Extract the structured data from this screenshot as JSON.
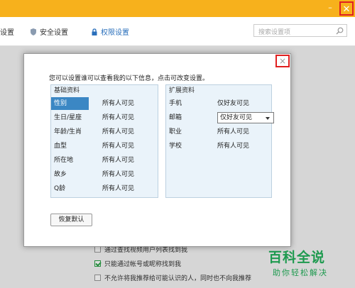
{
  "window": {
    "minimize_icon": "minus",
    "close_icon": "x"
  },
  "nav": {
    "items": [
      {
        "label": "设置",
        "icon": "none"
      },
      {
        "label": "安全设置",
        "icon": "shield-icon"
      },
      {
        "label": "权限设置",
        "icon": "lock-icon"
      }
    ],
    "search_placeholder": "搜索设置项"
  },
  "background_options": [
    {
      "label": "通过查找视频用户列表找到我",
      "checked": false
    },
    {
      "label": "只能通过帐号或昵称找到我",
      "checked": true
    },
    {
      "label": "不允许将我推荐给可能认识的人，同时也不向我推荐",
      "checked": false
    }
  ],
  "dialog": {
    "close_label": "×",
    "intro": "您可以设置谁可以查看我的以下信息，点击可改变设置。",
    "basic": {
      "title": "基础资料",
      "rows": [
        {
          "field": "性别",
          "value": "所有人可见"
        },
        {
          "field": "生日/星座",
          "value": "所有人可见"
        },
        {
          "field": "年龄/生肖",
          "value": "所有人可见"
        },
        {
          "field": "血型",
          "value": "所有人可见"
        },
        {
          "field": "所在地",
          "value": "所有人可见"
        },
        {
          "field": "故乡",
          "value": "所有人可见"
        },
        {
          "field": "Q龄",
          "value": "所有人可见"
        }
      ]
    },
    "extended": {
      "title": "扩展资料",
      "rows": [
        {
          "field": "手机",
          "value": "仅好友可见"
        },
        {
          "field": "邮箱",
          "value": "仅好友可见"
        },
        {
          "field": "职业",
          "value": "所有人可见"
        },
        {
          "field": "学校",
          "value": "所有人可见"
        }
      ]
    },
    "restore_label": "恢复默认"
  },
  "watermark": {
    "title": "百科全说",
    "subtitle": "助你轻松解决"
  },
  "colors": {
    "titlebar": "#f7b11c",
    "selected": "#3b87c4",
    "accent_red": "#e02020",
    "watermark": "#1e9a4f"
  }
}
